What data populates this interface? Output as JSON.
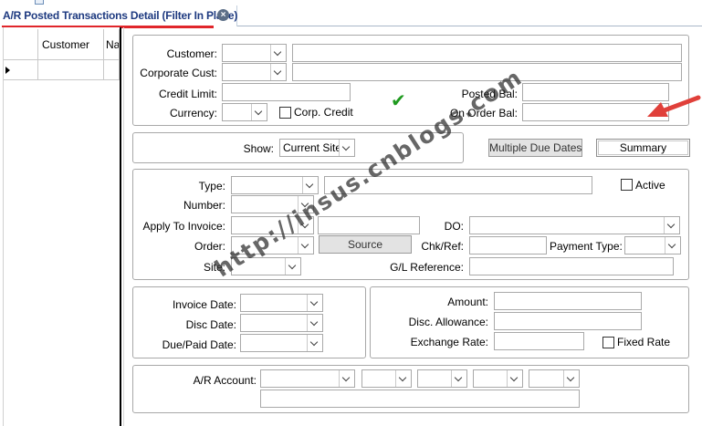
{
  "tab": {
    "title": "A/R Posted Transactions Detail (Filter In Place)"
  },
  "grid": {
    "columns": [
      "Customer",
      "Na"
    ]
  },
  "header": {
    "customer_label": "Customer:",
    "corporate_cust_label": "Corporate Cust:",
    "credit_limit_label": "Credit Limit:",
    "currency_label": "Currency:",
    "corp_credit_label": "Corp. Credit",
    "posted_bal_label": "Posted Bal:",
    "on_order_bal_label": "On Order Bal:",
    "checkmark": "✔"
  },
  "show": {
    "label": "Show:",
    "value": "Current Site",
    "multiple_due_dates_label": "Multiple Due Dates",
    "summary_label": "Summary"
  },
  "transaction": {
    "type_label": "Type:",
    "active_label": "Active",
    "number_label": "Number:",
    "apply_to_invoice_label": "Apply To Invoice:",
    "do_label": "DO:",
    "order_label": "Order:",
    "source_label": "Source",
    "chk_ref_label": "Chk/Ref:",
    "payment_type_label": "Payment Type:",
    "site_label": "Site:",
    "gl_reference_label": "G/L Reference:"
  },
  "dates": {
    "invoice_date_label": "Invoice Date:",
    "disc_date_label": "Disc Date:",
    "due_paid_date_label": "Due/Paid Date:"
  },
  "amounts": {
    "amount_label": "Amount:",
    "disc_allowance_label": "Disc. Allowance:",
    "exchange_rate_label": "Exchange Rate:",
    "fixed_rate_label": "Fixed Rate"
  },
  "account": {
    "ar_account_label": "A/R Account:"
  },
  "watermark": "http://insus.cnblogs.com",
  "colors": {
    "tab_text": "#1e3a80",
    "tab_underline": "#e0262b",
    "check": "#1f9a1f",
    "arrow": "#e0403a"
  }
}
